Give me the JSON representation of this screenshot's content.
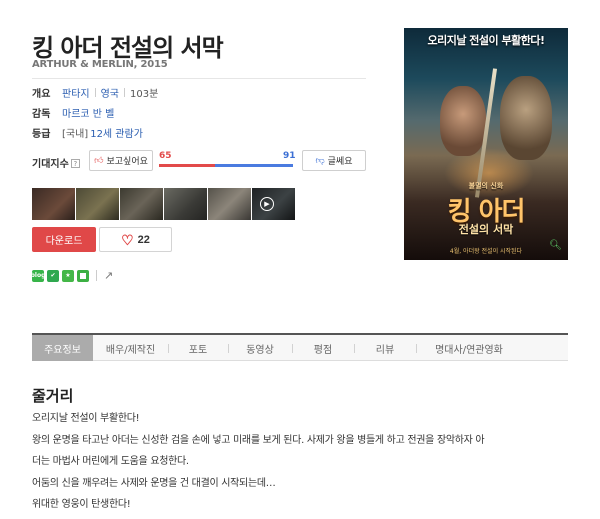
{
  "movie": {
    "title": "킹 아더 전설의 서막",
    "original": "ARTHUR & MERLIN, 2015"
  },
  "info": {
    "overview_label": "개요",
    "genre": "판타지",
    "country": "영국",
    "runtime": "103분",
    "director_label": "감독",
    "director": "마르코 반 벨",
    "rating_label": "등급",
    "rating_region": "[국내]",
    "rating": "12세 관람가"
  },
  "expectation": {
    "label": "기대지수",
    "help_icon": "?",
    "like_label": "보고싶어요",
    "dislike_label": "글쎄요",
    "like_count": 65,
    "dislike_count": 91,
    "like_share": 0.417
  },
  "gallery": {
    "count": 6,
    "play_icon": "play-icon"
  },
  "actions": {
    "download_label": "다운로드",
    "heart_count": "22"
  },
  "share": {
    "icons": [
      "blog-icon",
      "share-icon",
      "star-icon",
      "square-icon",
      "external-share-icon"
    ]
  },
  "poster": {
    "banner": "오리지날 전설이 부활한다!",
    "small_text": "불멸의 신화",
    "main_title": "킹 아더",
    "sub_title": "전설의 서막",
    "footer": "4월, 아더왕 전설이 시작된다",
    "zoom_icon": "zoom-icon"
  },
  "tabs": [
    "주요정보",
    "배우/제작진",
    "포토",
    "동영상",
    "평점",
    "리뷰",
    "명대사/연관영화"
  ],
  "synopsis": {
    "heading": "줄거리",
    "lines": [
      "오리지날 전설이 부활한다!",
      " 왕의 운명을 타고난 아더는 신성한 검을 손에 넣고 미래를 보게 된다. 사제가 왕을 병들게 하고 전권을 장악하자 아",
      "더는 마법사 머린에게 도움을 요청한다.",
      " 어둠의 신을 깨우려는 사제와 운명을 건 대결이 시작되는데…",
      " 위대한 영웅이 탄생한다!"
    ]
  }
}
